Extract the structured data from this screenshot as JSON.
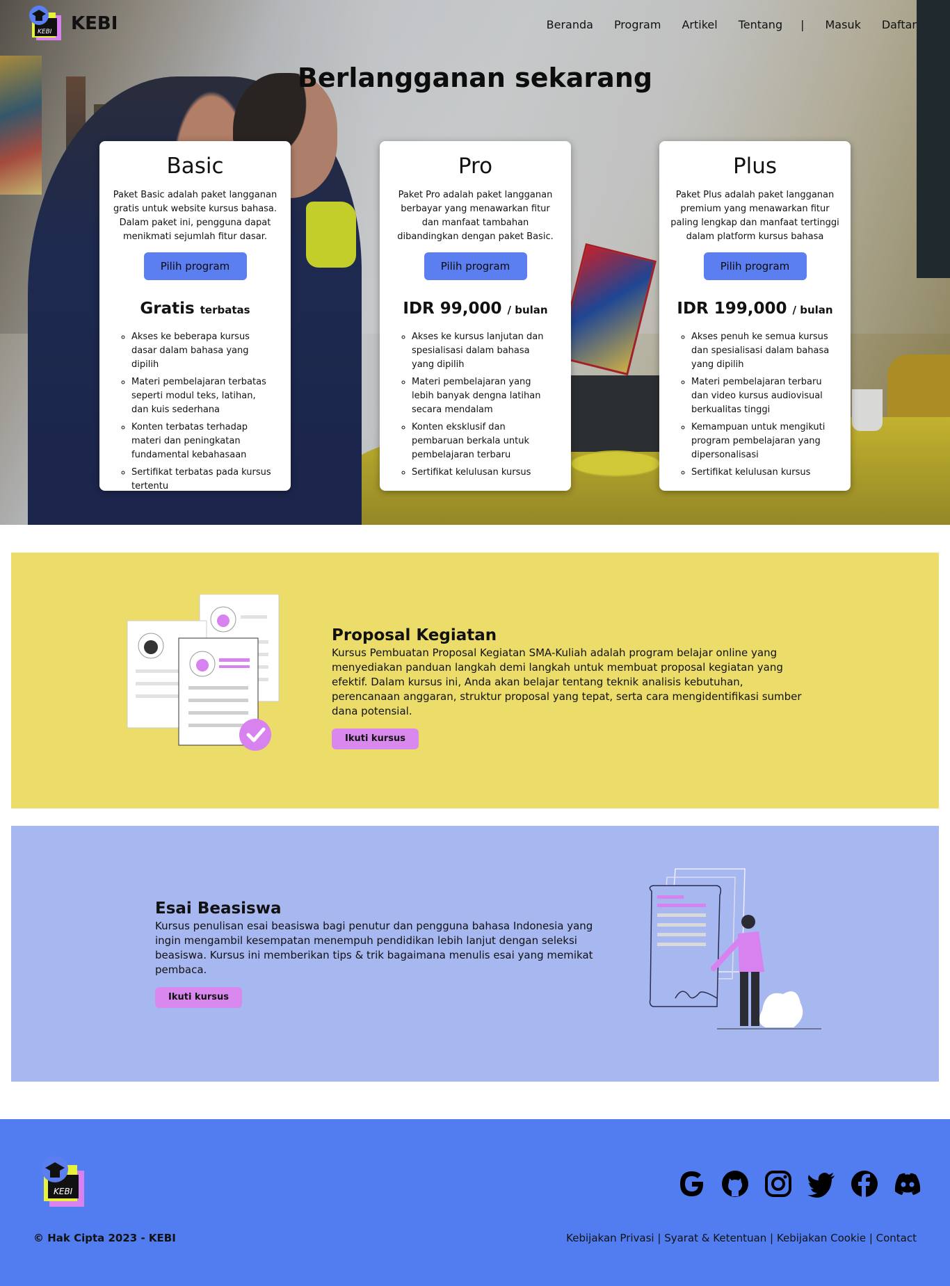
{
  "brand": {
    "name": "KEBI",
    "logo_text": "KEBI"
  },
  "nav": {
    "items": [
      "Beranda",
      "Program",
      "Artikel",
      "Tentang"
    ],
    "separator": "|",
    "login": "Masuk",
    "register": "Daftar"
  },
  "hero": {
    "title": "Berlangganan sekarang"
  },
  "plans": [
    {
      "name": "Basic",
      "description": "Paket Basic adalah paket langganan gratis untuk website kursus bahasa. Dalam paket ini, pengguna dapat menikmati sejumlah fitur dasar.",
      "button": "Pilih program",
      "price": "Gratis",
      "period": "terbatas",
      "features": [
        "Akses ke beberapa kursus dasar dalam bahasa yang dipilih",
        "Materi pembelajaran terbatas seperti modul teks, latihan, dan kuis sederhana",
        "Konten terbatas terhadap materi dan peningkatan fundamental kebahasaan",
        "Sertifikat terbatas pada kursus tertentu"
      ]
    },
    {
      "name": "Pro",
      "description": "Paket Pro adalah paket langganan berbayar yang menawarkan fitur dan manfaat tambahan dibandingkan dengan paket Basic.",
      "button": "Pilih program",
      "price": "IDR 99,000",
      "period": "/ bulan",
      "features": [
        "Akses ke kursus lanjutan dan spesialisasi dalam bahasa yang dipilih",
        "Materi pembelajaran yang lebih banyak dengna latihan secara mendalam",
        "Konten eksklusif dan pembaruan berkala untuk pembelajaran terbaru",
        "Sertifikat kelulusan kursus"
      ]
    },
    {
      "name": "Plus",
      "description": "Paket Plus adalah paket langganan premium yang menawarkan fitur paling lengkap dan manfaat tertinggi dalam platform kursus bahasa",
      "button": "Pilih program",
      "price": "IDR 199,000",
      "period": "/ bulan",
      "features": [
        "Akses penuh ke semua kursus dan spesialisasi dalam bahasa yang dipilih",
        "Materi pembelajaran terbaru dan video kursus audiovisual berkualitas tinggi",
        "Kemampuan untuk mengikuti program pembelajaran yang dipersonalisasi",
        "Sertifikat kelulusan kursus"
      ]
    }
  ],
  "courses": [
    {
      "title": "Proposal Kegiatan",
      "description": "Kursus Pembuatan Proposal Kegiatan SMA-Kuliah adalah program belajar online yang menyediakan panduan langkah demi langkah untuk membuat proposal kegiatan yang efektif. Dalam kursus ini, Anda akan belajar tentang teknik analisis kebutuhan, perencanaan anggaran, struktur proposal yang tepat, serta cara mengidentifikasi sumber dana potensial.",
      "button": "Ikuti kursus"
    },
    {
      "title": "Esai Beasiswa",
      "description": "Kursus penulisan esai beasiswa bagi penutur dan pengguna bahasa Indonesia yang ingin mengambil kesempatan menempuh pendidikan lebih lanjut dengan seleksi beasiswa. Kursus ini memberikan tips & trik bagaimana menulis esai yang memikat pembaca.",
      "button": "Ikuti kursus"
    }
  ],
  "footer": {
    "copyright": "© Hak Cipta 2023 - KEBI",
    "links": [
      "Kebijakan Privasi",
      "Syarat & Ketentuan",
      "Kebijakan Cookie",
      "Contact"
    ],
    "link_separator": " | ",
    "socials": [
      "google-icon",
      "github-icon",
      "instagram-icon",
      "twitter-icon",
      "facebook-icon",
      "discord-icon"
    ]
  },
  "colors": {
    "accent_blue": "#527df0",
    "button_blue": "#5b7ff0",
    "yellow_section": "#ecdd6a",
    "blue_section": "#a7b7f0",
    "pink_button": "#d989ee"
  }
}
